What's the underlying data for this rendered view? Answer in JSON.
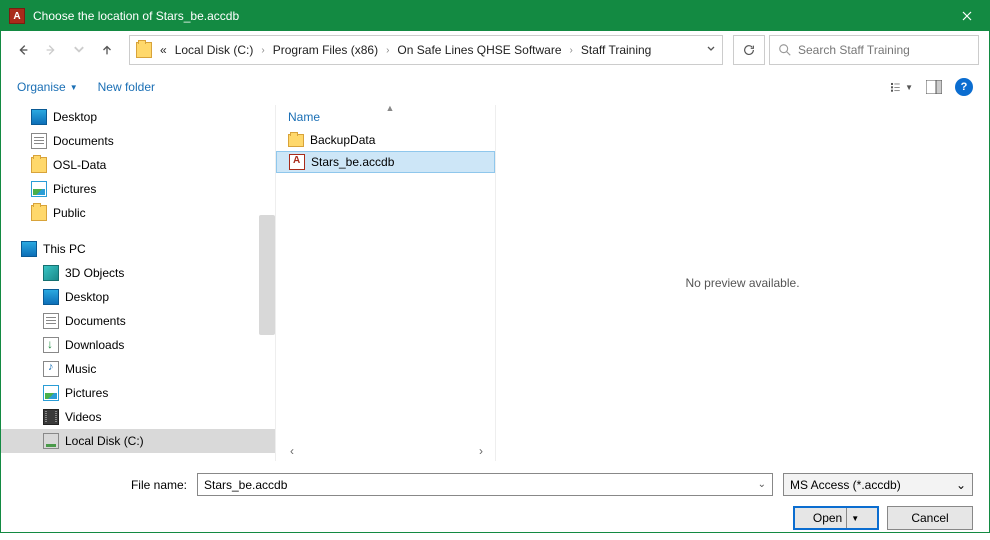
{
  "titlebar": {
    "title": "Choose the location of Stars_be.accdb"
  },
  "breadcrumb": {
    "prefix": "«",
    "items": [
      "Local Disk (C:)",
      "Program Files (x86)",
      "On Safe Lines QHSE Software",
      "Staff Training"
    ]
  },
  "search": {
    "placeholder": "Search Staff Training"
  },
  "toolbar": {
    "organise": "Organise",
    "new_folder": "New folder"
  },
  "tree": {
    "quick": [
      {
        "label": "Desktop",
        "icon": "desktop"
      },
      {
        "label": "Documents",
        "icon": "doc"
      },
      {
        "label": "OSL-Data",
        "icon": "folder"
      },
      {
        "label": "Pictures",
        "icon": "pic"
      },
      {
        "label": "Public",
        "icon": "folder"
      }
    ],
    "this_pc_label": "This PC",
    "this_pc": [
      {
        "label": "3D Objects",
        "icon": "3d"
      },
      {
        "label": "Desktop",
        "icon": "desktop"
      },
      {
        "label": "Documents",
        "icon": "doc"
      },
      {
        "label": "Downloads",
        "icon": "dl"
      },
      {
        "label": "Music",
        "icon": "music"
      },
      {
        "label": "Pictures",
        "icon": "pic"
      },
      {
        "label": "Videos",
        "icon": "vid"
      },
      {
        "label": "Local Disk (C:)",
        "icon": "disk",
        "selected": true
      }
    ]
  },
  "list": {
    "header": "Name",
    "items": [
      {
        "label": "BackupData",
        "icon": "folder"
      },
      {
        "label": "Stars_be.accdb",
        "icon": "access",
        "selected": true
      }
    ]
  },
  "preview": {
    "text": "No preview available."
  },
  "footer": {
    "filename_label": "File name:",
    "filename_value": "Stars_be.accdb",
    "filter": "MS Access (*.accdb)",
    "open": "Open",
    "cancel": "Cancel"
  }
}
